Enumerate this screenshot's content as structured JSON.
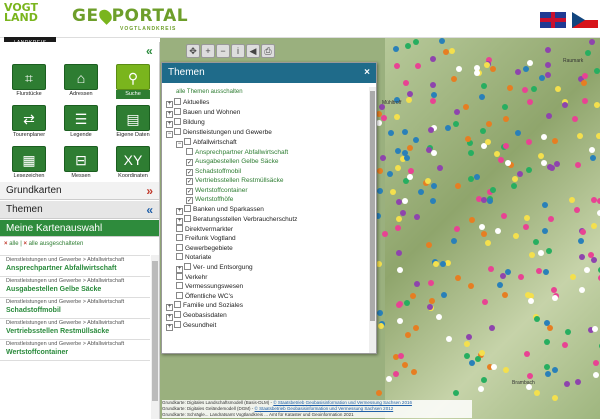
{
  "header": {
    "logo_text": "VOGT LAND",
    "logo_sub": "LANDKREIS",
    "portal_prefix": "GE",
    "portal_suffix": "PORTAL",
    "portal_sub": "VOGTLANDKREIS"
  },
  "tools": [
    {
      "label": "Flurstücke",
      "icon": "parcel-icon"
    },
    {
      "label": "Adressen",
      "icon": "house-icon"
    },
    {
      "label": "Suche",
      "icon": "search-icon",
      "active": true
    },
    {
      "label": "Tourenplaner",
      "icon": "route-icon"
    },
    {
      "label": "Legende",
      "icon": "legend-icon"
    },
    {
      "label": "Eigene Daten",
      "icon": "data-icon"
    },
    {
      "label": "Lesezeichen",
      "icon": "bookmark-icon"
    },
    {
      "label": "Messen",
      "icon": "ruler-icon"
    },
    {
      "label": "Koordinaten",
      "icon": "xy-icon"
    }
  ],
  "sidebar": {
    "grundkarten": "Grundkarten",
    "themen": "Themen",
    "meine_kartenauswahl": "Meine Kartenauswahl",
    "select_all": "alle",
    "deselect_all": "alle ausgeschalteten",
    "items": [
      {
        "cat": "Dienstleistungen und Gewerbe > Abfallwirtschaft",
        "name": "Ansprechpartner Abfallwirtschaft"
      },
      {
        "cat": "Dienstleistungen und Gewerbe > Abfallwirtschaft",
        "name": "Ausgabestellen Gelbe Säcke"
      },
      {
        "cat": "Dienstleistungen und Gewerbe > Abfallwirtschaft",
        "name": "Schadstoffmobil"
      },
      {
        "cat": "Dienstleistungen und Gewerbe > Abfallwirtschaft",
        "name": "Vertriebsstellen Restmüllsäcke"
      },
      {
        "cat": "Dienstleistungen und Gewerbe > Abfallwirtschaft",
        "name": "Wertstoffcontainer"
      }
    ]
  },
  "themes_panel": {
    "title": "Themen",
    "close": "×",
    "none_link": "alle Themen ausschalten",
    "tree": [
      {
        "level": 0,
        "exp": "+",
        "text": "Aktuelles"
      },
      {
        "level": 0,
        "exp": "+",
        "text": "Bauen und Wohnen"
      },
      {
        "level": 0,
        "exp": "+",
        "text": "Bildung"
      },
      {
        "level": 0,
        "exp": "−",
        "text": "Dienstleistungen und Gewerbe"
      },
      {
        "level": 1,
        "exp": "−",
        "text": "Abfallwirtschaft"
      },
      {
        "level": 2,
        "exp": "",
        "text": "Ansprechpartner Abfallwirtschaft",
        "checked": false,
        "green": true
      },
      {
        "level": 2,
        "exp": "",
        "text": "Ausgabestellen Gelbe Säcke",
        "checked": true,
        "green": true
      },
      {
        "level": 2,
        "exp": "",
        "text": "Schadstoffmobil",
        "checked": true,
        "green": true
      },
      {
        "level": 2,
        "exp": "",
        "text": "Vertriebsstellen Restmüllsäcke",
        "checked": true,
        "green": true
      },
      {
        "level": 2,
        "exp": "",
        "text": "Wertstoffcontainer",
        "checked": true,
        "green": true
      },
      {
        "level": 2,
        "exp": "",
        "text": "Wertstoffhöfe",
        "checked": true,
        "green": true
      },
      {
        "level": 1,
        "exp": "+",
        "text": "Banken und Sparkassen"
      },
      {
        "level": 1,
        "exp": "+",
        "text": "Beratungsstellen Verbraucherschutz"
      },
      {
        "level": 1,
        "exp": "",
        "text": "Direktvermarkter",
        "checked": false
      },
      {
        "level": 1,
        "exp": "",
        "text": "Freifunk Vogtland",
        "checked": false
      },
      {
        "level": 1,
        "exp": "",
        "text": "Gewerbegebiete",
        "checked": false
      },
      {
        "level": 1,
        "exp": "",
        "text": "Notariate",
        "checked": false
      },
      {
        "level": 1,
        "exp": "+",
        "text": "Ver- und Entsorgung"
      },
      {
        "level": 1,
        "exp": "",
        "text": "Verkehr",
        "checked": false
      },
      {
        "level": 1,
        "exp": "",
        "text": "Vermessungswesen",
        "checked": false
      },
      {
        "level": 1,
        "exp": "",
        "text": "Öffentliche WC's",
        "checked": false
      },
      {
        "level": 0,
        "exp": "+",
        "text": "Familie und Soziales"
      },
      {
        "level": 0,
        "exp": "+",
        "text": "Geobasisdaten"
      },
      {
        "level": 0,
        "exp": "+",
        "text": "Gesundheit"
      }
    ]
  },
  "map": {
    "labels": [
      "Mühltroff",
      "Brambach",
      "Raumark"
    ],
    "attribution": [
      {
        "pre": "Grundkarte: Digitales Landschaftsmodell (Basis-DLM) - ",
        "link": "© Staatsbetrieb Geobasisinformation und Vermessung Sachsen 2016"
      },
      {
        "pre": "Grundkarte: Digitales Geländemodell (DGM) - ",
        "link": "© Staatsbetrieb Geobasisinformation und Vermessung Sachsen 2012"
      },
      {
        "pre": "Grundkarte: Schrägle... Landratsamt Vogtlandkreis ... Amt für Kataster und Geoinformation 2021",
        "link": ""
      }
    ]
  },
  "colors": {
    "green": "#2e7d32",
    "accent": "#7ab51d",
    "panel_title": "#1f6b8a"
  }
}
